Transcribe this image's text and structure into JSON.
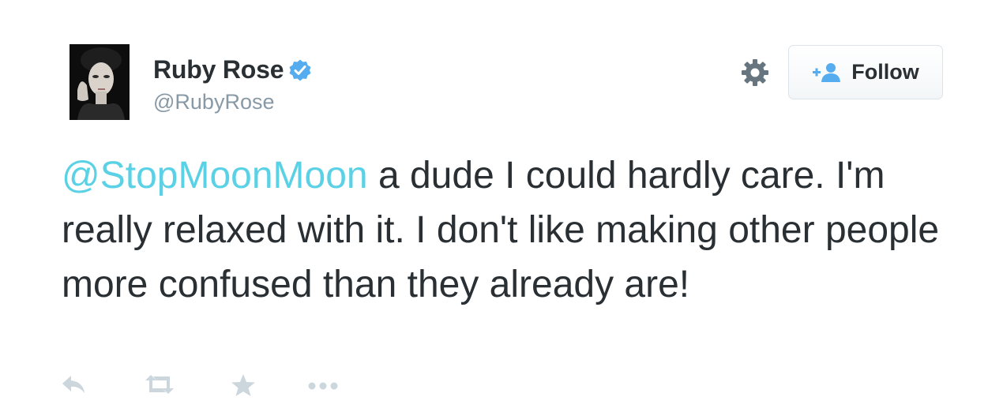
{
  "user": {
    "display_name": "Ruby Rose",
    "handle": "@RubyRose",
    "verified": true,
    "avatar": "profile-photo"
  },
  "header": {
    "follow_label": "Follow",
    "follow_icon": "add-user-icon",
    "settings_icon": "gear-icon"
  },
  "tweet": {
    "mention": "@StopMoonMoon",
    "text": " a dude I could hardly care. I'm really relaxed with it. I don't like making other people more confused than they already are!"
  },
  "actions": {
    "icons": [
      "reply-icon",
      "retweet-icon",
      "favorite-icon",
      "more-icon"
    ]
  },
  "colors": {
    "text": "#292f33",
    "secondary_text": "#8899a6",
    "mention": "#5bd1e6",
    "verified": "#55acee",
    "icon_gray": "#ccd6dd",
    "gear": "#66757f"
  }
}
